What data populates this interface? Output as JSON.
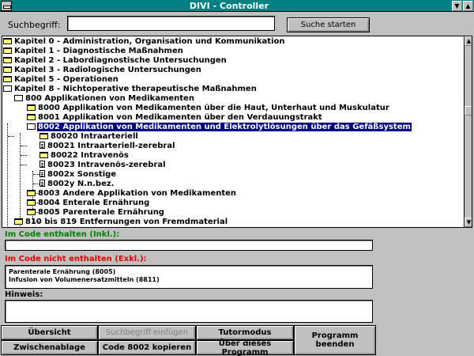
{
  "window": {
    "title": "DIVI - Controller",
    "minimize_glyph": "▼",
    "maximize_glyph": "▲"
  },
  "search": {
    "label": "Suchbegriff:",
    "value": "",
    "button": "Suche starten"
  },
  "tree": [
    {
      "text": "Kapitel 0 - Administration, Organisation und Kommunikation",
      "icon": "folder"
    },
    {
      "text": "Kapitel 1 - Diagnostische Maßnahmen",
      "icon": "folder"
    },
    {
      "text": "Kapitel 2 - Labordiagnostische Untersuchungen",
      "icon": "folder"
    },
    {
      "text": "Kapitel 3 - Radiologische Untersuchungen",
      "icon": "folder"
    },
    {
      "text": "Kapitel 5 - Operationen",
      "icon": "folder"
    },
    {
      "text": "Kapitel 8 - Nichtoperative therapeutische Maßnahmen",
      "icon": "folder-open"
    },
    {
      "text": "800 Applikationen von Medikamenten",
      "icon": "folder-open"
    },
    {
      "text": "8000  Applikation von Medikamenten über die Haut, Unterhaut und Muskulatur",
      "icon": "folder"
    },
    {
      "text": "8001  Applikation von Medikamenten über den Verdauungstrakt",
      "icon": "folder"
    },
    {
      "text": "8002  Applikation von Medikamenten und Elektrolytlösungen über das Gefäßsystem",
      "icon": "folder-open"
    },
    {
      "text": "80020 Intraarteriell",
      "icon": "folder"
    },
    {
      "text": "80021 Intraarteriell-zerebral",
      "icon": "document"
    },
    {
      "text": "80022 Intravenös",
      "icon": "folder"
    },
    {
      "text": "80023 Intravenös-zerebral",
      "icon": "document"
    },
    {
      "text": "8002x Sonstige",
      "icon": "document"
    },
    {
      "text": "8002y N.n.bez.",
      "icon": "document"
    },
    {
      "text": "8003  Andere Applikation von Medikamenten",
      "icon": "folder"
    },
    {
      "text": "8004  Enterale Ernährung",
      "icon": "folder"
    },
    {
      "text": "8005  Parenterale Ernährung",
      "icon": "folder"
    },
    {
      "text": "810 bis 819 Entfernungen von Fremdmaterial",
      "icon": "folder"
    }
  ],
  "inklusive": {
    "label": "Im Code enthalten (Inkl.):",
    "value": ""
  },
  "exklusive": {
    "label": "Im Code nicht enthalten (Exkl.):",
    "lines": [
      "Parenterale Ernährung (8005)",
      "Infusion von Volumenersatzmitteln (8811)"
    ]
  },
  "hinweis": {
    "label": "Hinweis:",
    "value": ""
  },
  "buttons": {
    "uebersicht": "Übersicht",
    "suchbegriff_einfuegen": "Suchbegriff einfügen",
    "tutormodus": "Tutormodus",
    "programm_beenden": "Programm beenden",
    "zwischenablage": "Zwischenablage",
    "code_kopieren": "Code 8002  kopieren",
    "ueber": "Über dieses Programm"
  },
  "colors": {
    "titlebar": "#008080",
    "selection": "#000080",
    "inkl_label": "#008000",
    "exkl_label": "#e00000"
  }
}
